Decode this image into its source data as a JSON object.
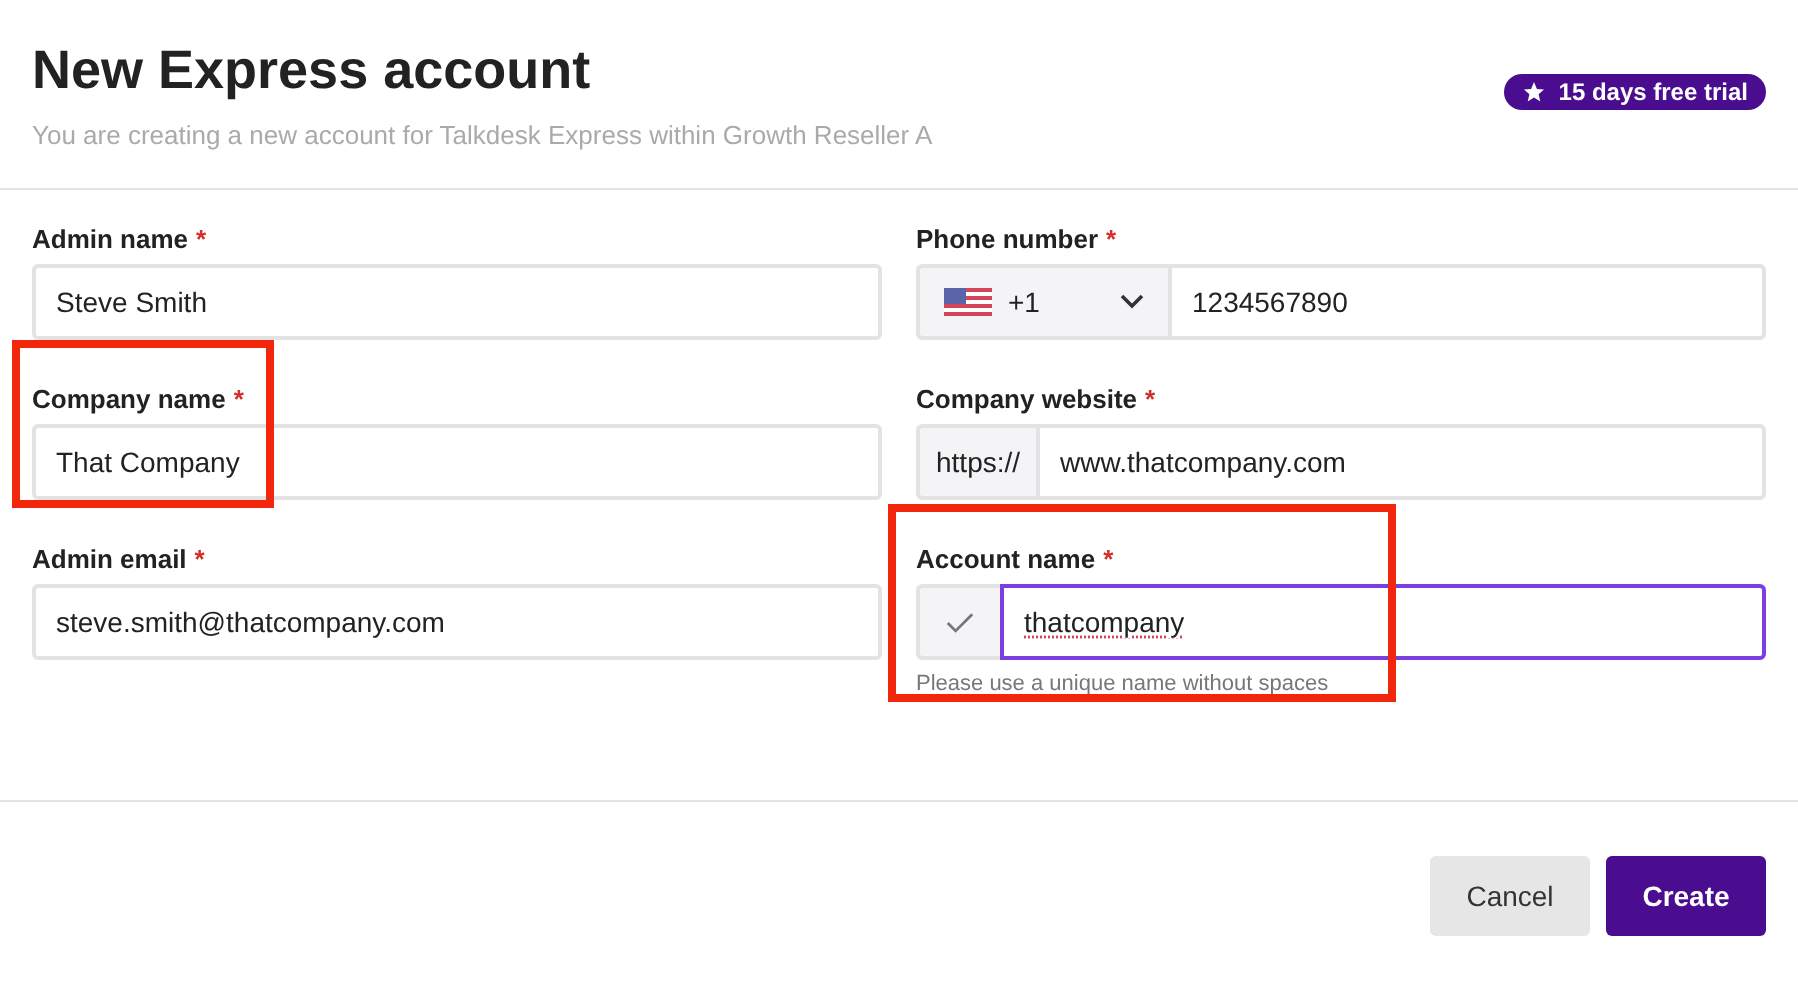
{
  "dialog": {
    "title": "New Express account",
    "subtitle": "You are creating a new account for Talkdesk Express within Growth Reseller A",
    "badge": "15 days free trial"
  },
  "fields": [
    {
      "kind": "text",
      "label": "Admin name",
      "required": "*",
      "value": "Steve Smith",
      "focused": false,
      "highlighted": false
    },
    {
      "kind": "phone",
      "label": "Phone number",
      "required": "*",
      "dial_code": "+1",
      "value": "1234567890",
      "focused": false,
      "highlighted": false
    },
    {
      "kind": "text",
      "label": "Company name",
      "required": "*",
      "value": "That Company",
      "focused": false,
      "highlighted": true
    },
    {
      "kind": "prefixed",
      "label": "Company website",
      "required": "*",
      "prefix": "https://",
      "value": "www.thatcompany.com",
      "focused": false,
      "highlighted": false
    },
    {
      "kind": "text",
      "label": "Admin email",
      "required": "*",
      "value": "steve.smith@thatcompany.com",
      "focused": false,
      "highlighted": false
    },
    {
      "kind": "validated",
      "label": "Account name",
      "required": "*",
      "value": "thatcompany",
      "hint": "Please use a unique name without spaces",
      "focused": true,
      "highlighted": true
    }
  ],
  "buttons": [
    {
      "label": "Cancel",
      "kind": "secondary"
    },
    {
      "label": "Create",
      "kind": "primary"
    }
  ]
}
